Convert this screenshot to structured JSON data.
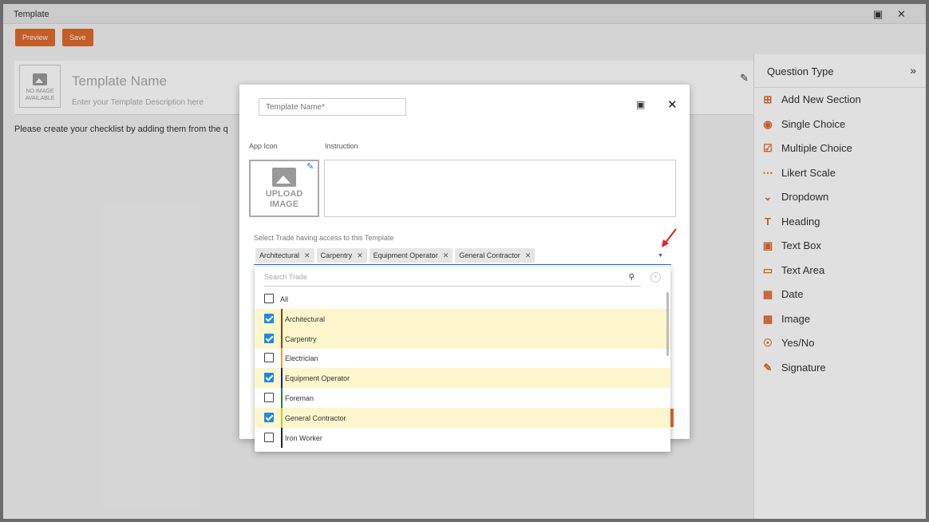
{
  "window": {
    "title": "Template",
    "maximize_icon": "maximize-icon",
    "close_icon": "close-icon"
  },
  "toolbar": {
    "preview_label": "Preview",
    "save_label": "Save"
  },
  "header": {
    "no_image_text": "NO IMAGE AVAILABLE",
    "template_name": "Template Name",
    "template_desc": "Enter your Template Description here"
  },
  "main": {
    "hint": "Please create your checklist by adding them from the q"
  },
  "question_type": {
    "title": "Question Type",
    "items": [
      {
        "label": "Add New Section",
        "icon": "add-section-icon"
      },
      {
        "label": "Single Choice",
        "icon": "radio-icon"
      },
      {
        "label": "Multiple Choice",
        "icon": "checkbox-icon"
      },
      {
        "label": "Likert Scale",
        "icon": "likert-icon"
      },
      {
        "label": "Dropdown",
        "icon": "chevron-down-icon"
      },
      {
        "label": "Heading",
        "icon": "heading-icon"
      },
      {
        "label": "Text Box",
        "icon": "textbox-icon"
      },
      {
        "label": "Text Area",
        "icon": "textarea-icon"
      },
      {
        "label": "Date",
        "icon": "calendar-icon"
      },
      {
        "label": "Image",
        "icon": "image-icon"
      },
      {
        "label": "Yes/No",
        "icon": "yes-no-icon"
      },
      {
        "label": "Signature",
        "icon": "pen-icon"
      }
    ]
  },
  "modal": {
    "name_placeholder": "Template Name*",
    "app_icon_label": "App Icon",
    "instruction_label": "Instruction",
    "upload_label": "UPLOAD IMAGE",
    "trade_label": "Select Trade having access to this Template",
    "chips": [
      "Architectural",
      "Carpentry",
      "Equipment Operator",
      "General Contractor"
    ]
  },
  "dropdown": {
    "search_placeholder": "Search Trade",
    "options": [
      {
        "label": "All",
        "checked": false,
        "color": ""
      },
      {
        "label": "Architectural",
        "checked": true,
        "color": "#7a4a10"
      },
      {
        "label": "Carpentry",
        "checked": true,
        "color": "#7a4a10"
      },
      {
        "label": "Electrician",
        "checked": false,
        "color": "#f0a020"
      },
      {
        "label": "Equipment Operator",
        "checked": true,
        "color": "#1a237e"
      },
      {
        "label": "Foreman",
        "checked": false,
        "color": "#2e7d32"
      },
      {
        "label": "General Contractor",
        "checked": true,
        "color": "#c0ca33"
      },
      {
        "label": "Iron Worker",
        "checked": false,
        "color": "#222222"
      }
    ]
  }
}
